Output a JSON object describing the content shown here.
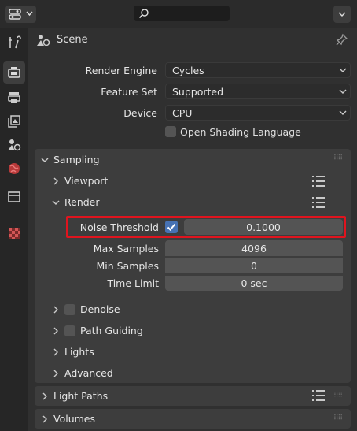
{
  "header": {
    "editor_type_icon": "properties-editor-icon",
    "search_placeholder": "",
    "right_menu_icon": "chevron-down-icon"
  },
  "tabs": [
    {
      "name": "tool",
      "icon": "tool-icon"
    },
    {
      "name": "render",
      "icon": "render-icon",
      "active": true
    },
    {
      "name": "output",
      "icon": "output-icon"
    },
    {
      "name": "view-layer",
      "icon": "view-layer-icon"
    },
    {
      "name": "scene",
      "icon": "scene-icon"
    },
    {
      "name": "world",
      "icon": "world-icon"
    },
    {
      "name": "collection",
      "icon": "collection-icon"
    },
    {
      "name": "texture",
      "icon": "texture-icon"
    }
  ],
  "breadcrumb": {
    "label": "Scene"
  },
  "render": {
    "engine_label": "Render Engine",
    "engine_value": "Cycles",
    "feature_label": "Feature Set",
    "feature_value": "Supported",
    "device_label": "Device",
    "device_value": "CPU",
    "osl_label": "Open Shading Language"
  },
  "sampling": {
    "title": "Sampling",
    "viewport_label": "Viewport",
    "render_label": "Render",
    "noise_threshold_label": "Noise Threshold",
    "noise_threshold_enabled": true,
    "noise_threshold_value": "0.1000",
    "max_samples_label": "Max Samples",
    "max_samples_value": "4096",
    "min_samples_label": "Min Samples",
    "min_samples_value": "0",
    "time_limit_label": "Time Limit",
    "time_limit_value": "0 sec",
    "denoise_label": "Denoise",
    "path_guiding_label": "Path Guiding",
    "lights_label": "Lights",
    "advanced_label": "Advanced"
  },
  "panels": {
    "light_paths": "Light Paths",
    "volumes": "Volumes"
  },
  "colors": {
    "highlight_box": "#e0141e",
    "checkbox_checked": "#4772b3"
  }
}
